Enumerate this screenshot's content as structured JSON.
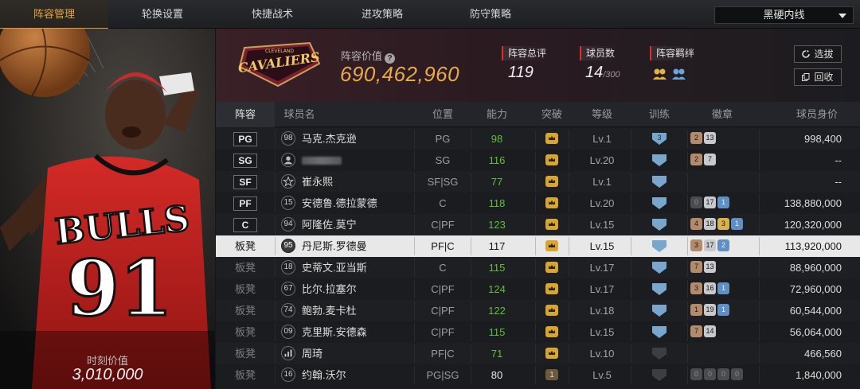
{
  "nav": {
    "tabs": [
      "阵容管理",
      "轮换设置",
      "快捷战术",
      "进攻策略",
      "防守策略"
    ],
    "active_tab": 0,
    "dropdown_value": "黑硬内线"
  },
  "hero": {
    "moment_label": "时刻价值",
    "moment_value": "3,010,000"
  },
  "team": {
    "logo_text": "CAVALIERS",
    "logo_sub": "CLEVELAND",
    "value_label": "阵容价值",
    "value": "690,462,960",
    "stats": [
      {
        "label": "阵容总评",
        "value": "119",
        "sub": ""
      },
      {
        "label": "球员数",
        "value": "14",
        "sub": "/300"
      },
      {
        "label": "阵容羁绊",
        "value": "",
        "sub": ""
      }
    ],
    "buttons": {
      "draft": "选拔",
      "recycle": "回收"
    }
  },
  "table": {
    "headers": [
      "阵容",
      "球员名",
      "位置",
      "能力",
      "突破",
      "等级",
      "训练",
      "徽章",
      "球员身价"
    ],
    "rows": [
      {
        "slot": "PG",
        "starter": true,
        "num": "98",
        "name": "马克.杰克逊",
        "position": "PG",
        "ability": "98",
        "ability_color": "green",
        "break": "crown",
        "level": "Lv.1",
        "train": "3",
        "badges": [
          [
            "bronze",
            "2"
          ],
          [
            "silver",
            "13"
          ]
        ],
        "price": "998,400"
      },
      {
        "slot": "SG",
        "starter": true,
        "num": "",
        "icon": "person",
        "name": "",
        "blurred": true,
        "position": "SG",
        "ability": "116",
        "ability_color": "green",
        "break": "crown",
        "level": "Lv.20",
        "train": "",
        "badges": [
          [
            "bronze",
            "2"
          ],
          [
            "silver",
            "7"
          ]
        ],
        "price": "--"
      },
      {
        "slot": "SF",
        "starter": true,
        "num": "",
        "icon": "star",
        "name": "崔永熙",
        "position": "SF|SG",
        "ability": "77",
        "ability_color": "green",
        "break": "crown",
        "level": "Lv.1",
        "train": "",
        "badges": [],
        "price": "--"
      },
      {
        "slot": "PF",
        "starter": true,
        "num": "15",
        "name": "安德鲁.德拉蒙德",
        "position": "C",
        "ability": "118",
        "ability_color": "green",
        "break": "crown",
        "level": "Lv.20",
        "train": "",
        "badges": [
          [
            "gray",
            "0"
          ],
          [
            "silver",
            "17"
          ],
          [
            "blue",
            "1"
          ]
        ],
        "price": "138,880,000"
      },
      {
        "slot": "C",
        "starter": true,
        "num": "94",
        "name": "阿隆佐.莫宁",
        "position": "C|PF",
        "ability": "123",
        "ability_color": "green",
        "break": "crown",
        "level": "Lv.15",
        "train": "",
        "badges": [
          [
            "bronze",
            "4"
          ],
          [
            "silver",
            "18"
          ],
          [
            "gold",
            "3"
          ],
          [
            "blue",
            "1"
          ]
        ],
        "price": "120,320,000"
      },
      {
        "slot": "板凳",
        "starter": false,
        "selected": true,
        "num": "95",
        "name": "丹尼斯.罗德曼",
        "position": "PF|C",
        "ability": "117",
        "ability_color": "white",
        "break": "crown",
        "level": "Lv.15",
        "train": "",
        "badges": [
          [
            "bronze",
            "3"
          ],
          [
            "silver",
            "17"
          ],
          [
            "blue",
            "2"
          ]
        ],
        "price": "113,920,000"
      },
      {
        "slot": "板凳",
        "starter": false,
        "num": "18",
        "name": "史蒂文.亚当斯",
        "position": "C",
        "ability": "115",
        "ability_color": "green",
        "break": "crown",
        "level": "Lv.17",
        "train": "",
        "badges": [
          [
            "bronze",
            "7"
          ],
          [
            "silver",
            "13"
          ]
        ],
        "price": "88,960,000"
      },
      {
        "slot": "板凳",
        "starter": false,
        "num": "67",
        "name": "比尔.拉塞尔",
        "position": "C|PF",
        "ability": "124",
        "ability_color": "green",
        "break": "crown",
        "level": "Lv.17",
        "train": "",
        "badges": [
          [
            "bronze",
            "3"
          ],
          [
            "silver",
            "16"
          ],
          [
            "blue",
            "1"
          ]
        ],
        "price": "72,960,000"
      },
      {
        "slot": "板凳",
        "starter": false,
        "num": "74",
        "name": "鲍勃.麦卡杜",
        "position": "C|PF",
        "ability": "122",
        "ability_color": "green",
        "break": "crown",
        "level": "Lv.18",
        "train": "",
        "badges": [
          [
            "bronze",
            "1"
          ],
          [
            "silver",
            "19"
          ],
          [
            "blue",
            "1"
          ]
        ],
        "price": "60,544,000"
      },
      {
        "slot": "板凳",
        "starter": false,
        "num": "09",
        "name": "克里斯.安德森",
        "position": "C|PF",
        "ability": "115",
        "ability_color": "green",
        "break": "crown",
        "level": "Lv.15",
        "train": "",
        "badges": [
          [
            "bronze",
            "7"
          ],
          [
            "silver",
            "14"
          ]
        ],
        "price": "56,064,000"
      },
      {
        "slot": "板凳",
        "starter": false,
        "num": "",
        "icon": "bars",
        "name": "周琦",
        "position": "PF|C",
        "ability": "71",
        "ability_color": "green",
        "break": "crown",
        "level": "Lv.10",
        "train": "dark",
        "badges": [],
        "price": "466,560"
      },
      {
        "slot": "板凳",
        "starter": false,
        "num": "16",
        "name": "约翰.沃尔",
        "position": "PG|SG",
        "ability": "80",
        "ability_color": "white",
        "break": "dim1",
        "level": "Lv.5",
        "train": "dark",
        "badges": [
          [
            "gray",
            "0"
          ],
          [
            "gray",
            "0"
          ],
          [
            "gray",
            "0"
          ],
          [
            "gray",
            "0"
          ]
        ],
        "price": "1,840,000"
      }
    ]
  },
  "colors": {
    "accent": "#e39a31",
    "ability_green": "#5fbf3c",
    "value_gold": "#e8a94a"
  }
}
